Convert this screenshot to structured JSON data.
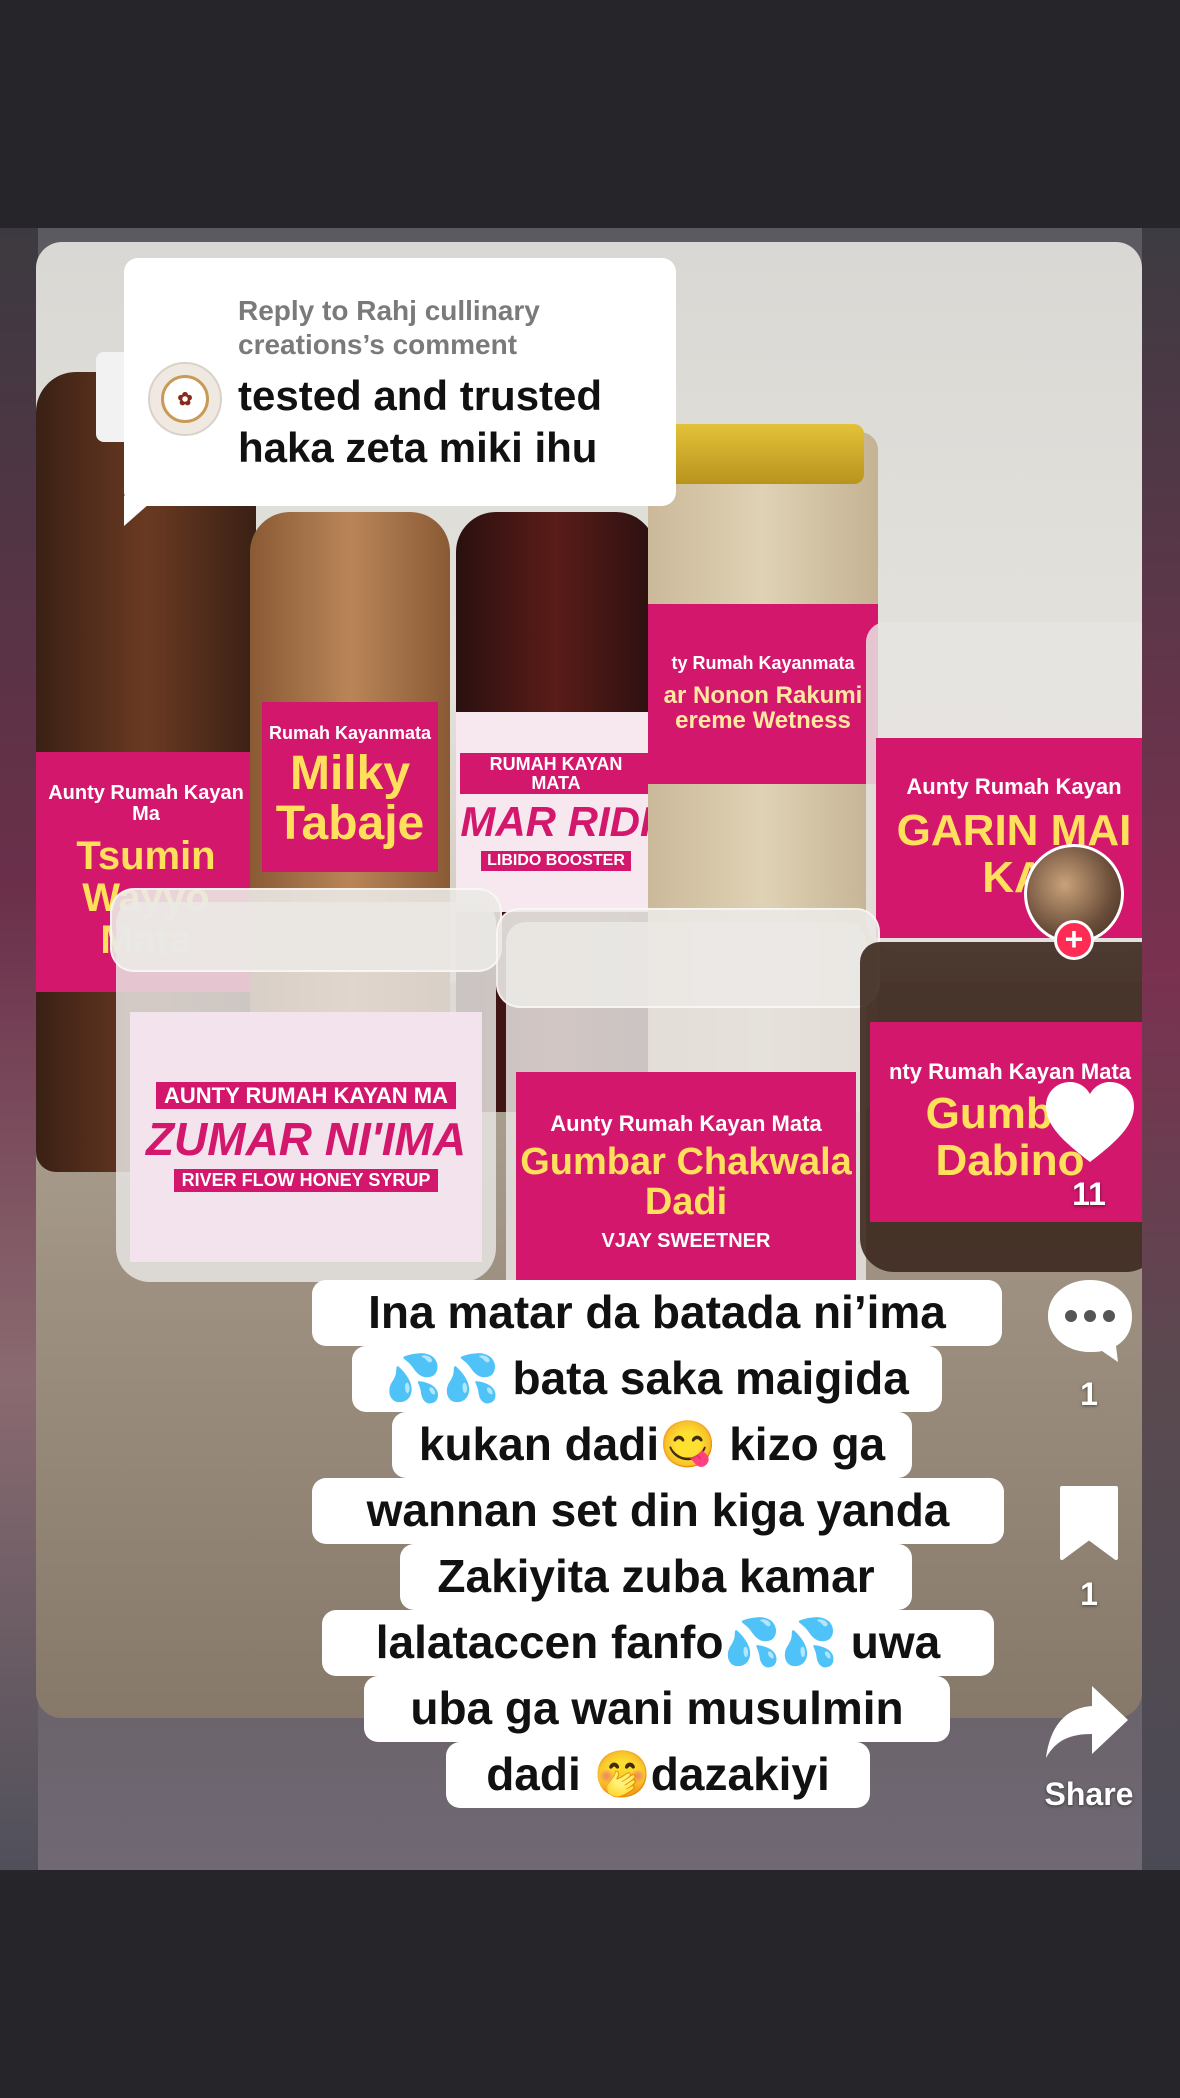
{
  "reply": {
    "reply_to": "Reply to Rahj cullinary creations’s comment",
    "comment_line1": "tested and trusted",
    "comment_line2": "haka zeta miki ihu"
  },
  "caption": {
    "lines": [
      "Ina matar da batada ni’ima",
      "💦💦 bata saka maigida",
      "kukan dadi😋 kizo ga",
      "wannan set din kiga yanda",
      "Zakiyita zuba kamar",
      "lalataccen fanfo💦💦 uwa",
      "uba ga wani musulmin",
      "dadi 🤭dazakiyi"
    ]
  },
  "actions": {
    "likes": "11",
    "comments": "1",
    "bookmarks": "1",
    "share_label": "Share"
  },
  "products": {
    "p1_brand": "Aunty Rumah Kayan Ma",
    "p1_name": "Tsumin Wayyo Mata",
    "p2_brand": "Rumah Kayanmata",
    "p2_name": "Milky Tabaje",
    "p3_brand": "RUMAH KAYAN MATA",
    "p3_name": "MAR RIDI",
    "p3_sub": "LIBIDO BOOSTER",
    "p4_brand": "ty Rumah Kayanmata",
    "p4_name": "ar Nonon Rakumi ereme Wetness",
    "p5_brand": "Aunty Rumah Kayan",
    "p5_name": "GARIN MAI KA",
    "p6_brand": "AUNTY RUMAH KAYAN MA",
    "p6_name": "ZUMAR NI'IMA",
    "p6_sub": "RIVER FLOW HONEY SYRUP",
    "p7_brand": "Aunty Rumah Kayan Mata",
    "p7_name": "Gumbar Chakwala Dadi",
    "p7_sub": "VJAY SWEETNER",
    "p8_brand": "nty Rumah Kayan Mata",
    "p8_name": "Gumbar Dabino"
  },
  "colors": {
    "label_pink": "#d3176c",
    "follow_red": "#fe2c55"
  }
}
